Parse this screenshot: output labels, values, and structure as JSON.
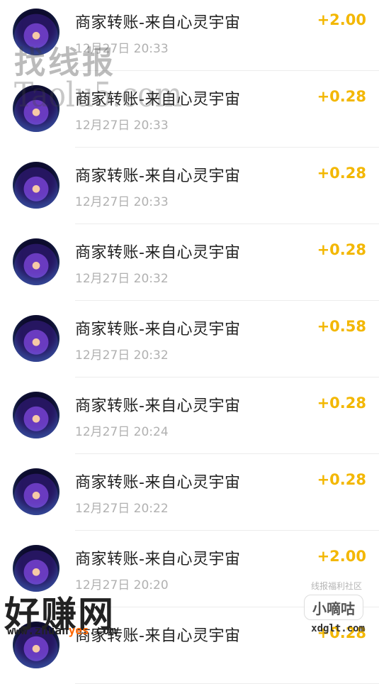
{
  "transactions": [
    {
      "title": "商家转账-来自心灵宇宙",
      "time": "12月27日 20:33",
      "amount": "+2.00"
    },
    {
      "title": "商家转账-来自心灵宇宙",
      "time": "12月27日 20:33",
      "amount": "+0.28"
    },
    {
      "title": "商家转账-来自心灵宇宙",
      "time": "12月27日 20:33",
      "amount": "+0.28"
    },
    {
      "title": "商家转账-来自心灵宇宙",
      "time": "12月27日 20:32",
      "amount": "+0.28"
    },
    {
      "title": "商家转账-来自心灵宇宙",
      "time": "12月27日 20:32",
      "amount": "+0.58"
    },
    {
      "title": "商家转账-来自心灵宇宙",
      "time": "12月27日 20:24",
      "amount": "+0.28"
    },
    {
      "title": "商家转账-来自心灵宇宙",
      "time": "12月27日 20:22",
      "amount": "+0.28"
    },
    {
      "title": "商家转账-来自心灵宇宙",
      "time": "12月27日 20:20",
      "amount": "+2.00"
    },
    {
      "title": "商家转账-来自心灵宇宙",
      "time": "",
      "amount": "+0.28"
    }
  ],
  "watermarks": {
    "top_cn": "找线报",
    "top_en": "Taolu5.com",
    "bottom_cn": "好赚网",
    "bottom_url_a": "www.zhuan",
    "bottom_url_b": "yes",
    "bottom_url_c": ".com",
    "right_caption": "线报福利社区",
    "right_logo": "小嘀咕",
    "right_url": "xdglt.com"
  },
  "colors": {
    "amount": "#f3b700",
    "title": "#222222",
    "time": "#b1b1b1"
  }
}
